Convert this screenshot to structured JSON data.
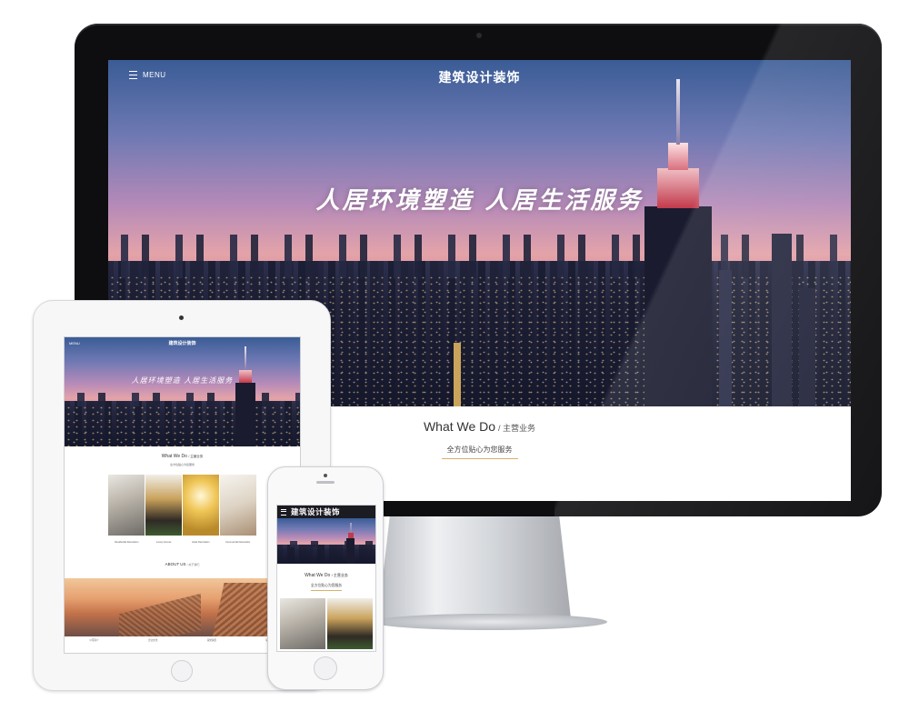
{
  "desktop": {
    "menu_label": "MENU",
    "site_title": "建筑设计装饰",
    "slogan": "人居环境塑造 人居生活服务",
    "section": {
      "title": "What We Do",
      "title_suffix": "/ 主营业务",
      "subtitle": "全方位贴心为您服务"
    }
  },
  "tablet": {
    "menu_label": "MENU",
    "site_title": "建筑设计装饰",
    "slogan": "人居环境塑造 人居生活服务",
    "section": {
      "title": "What We Do",
      "title_suffix": "/ 主营业务",
      "subtitle": "全方位贴心为您服务"
    },
    "services": [
      {
        "caption": "Residential Decoration"
      },
      {
        "caption": "Luxury Homes"
      },
      {
        "caption": "Hotel Decoration"
      },
      {
        "caption": "Commercial Decoration"
      }
    ],
    "about": {
      "title": "ABOUT US",
      "title_suffix": "/ 关于我们"
    },
    "footer_links": [
      "公司简介",
      "企业文化",
      "荣誉资质",
      "联系我们"
    ]
  },
  "phone": {
    "site_title": "建筑设计装饰",
    "section": {
      "title": "What We Do",
      "title_suffix": "/ 主营业务",
      "subtitle": "全方位贴心为您服务"
    }
  },
  "colors": {
    "accent_gold": "#d6b26b",
    "tower_red": "#c23a4c",
    "phone_header": "#1b1b22"
  }
}
